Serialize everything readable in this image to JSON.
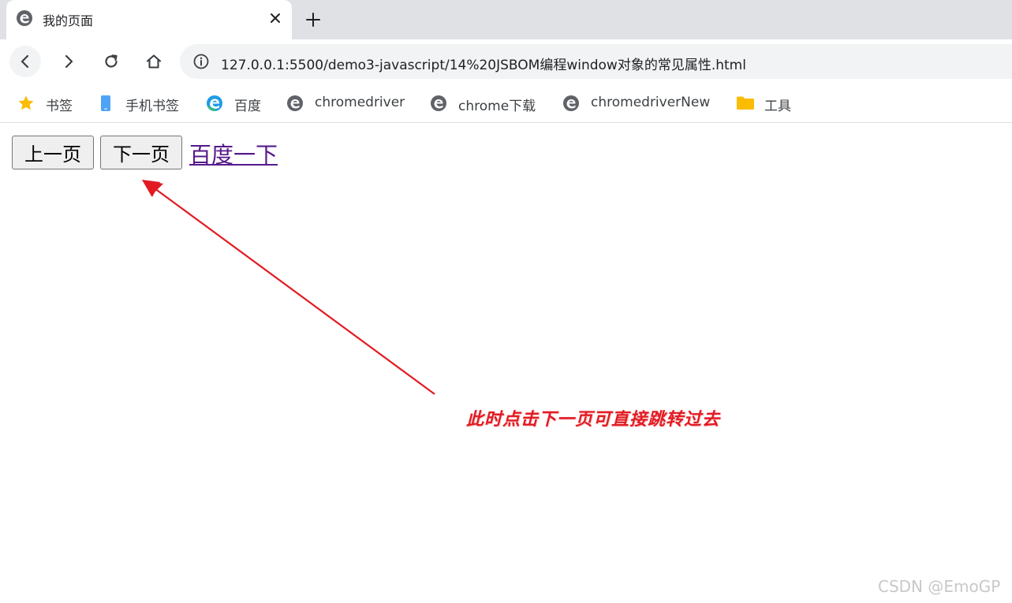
{
  "tab": {
    "title": "我的页面",
    "favicon": "edge-e-icon"
  },
  "toolbar": {
    "url": "127.0.0.1:5500/demo3-javascript/14%20JSBOM编程window对象的常见属性.html"
  },
  "bookmarks": [
    {
      "label": "书签",
      "icon": "star-icon"
    },
    {
      "label": "手机书签",
      "icon": "phone-icon"
    },
    {
      "label": "百度",
      "icon": "edge-icon"
    },
    {
      "label": "chromedriver",
      "icon": "edge-e-icon"
    },
    {
      "label": "chrome下载",
      "icon": "edge-e-icon"
    },
    {
      "label": "chromedriverNew",
      "icon": "edge-e-icon"
    },
    {
      "label": "工具",
      "icon": "folder-icon"
    }
  ],
  "page": {
    "prev_button": "上一页",
    "next_button": "下一页",
    "baidu_link": "百度一下"
  },
  "annotation": {
    "text": "此时点击下一页可直接跳转过去",
    "color": "#e21b23"
  },
  "watermark": "CSDN @EmoGP",
  "colors": {
    "tabstrip": "#dfe1e5",
    "omnibox": "#f1f3f4",
    "visited_link": "#551a8b",
    "annotation_red": "#e21b23"
  }
}
